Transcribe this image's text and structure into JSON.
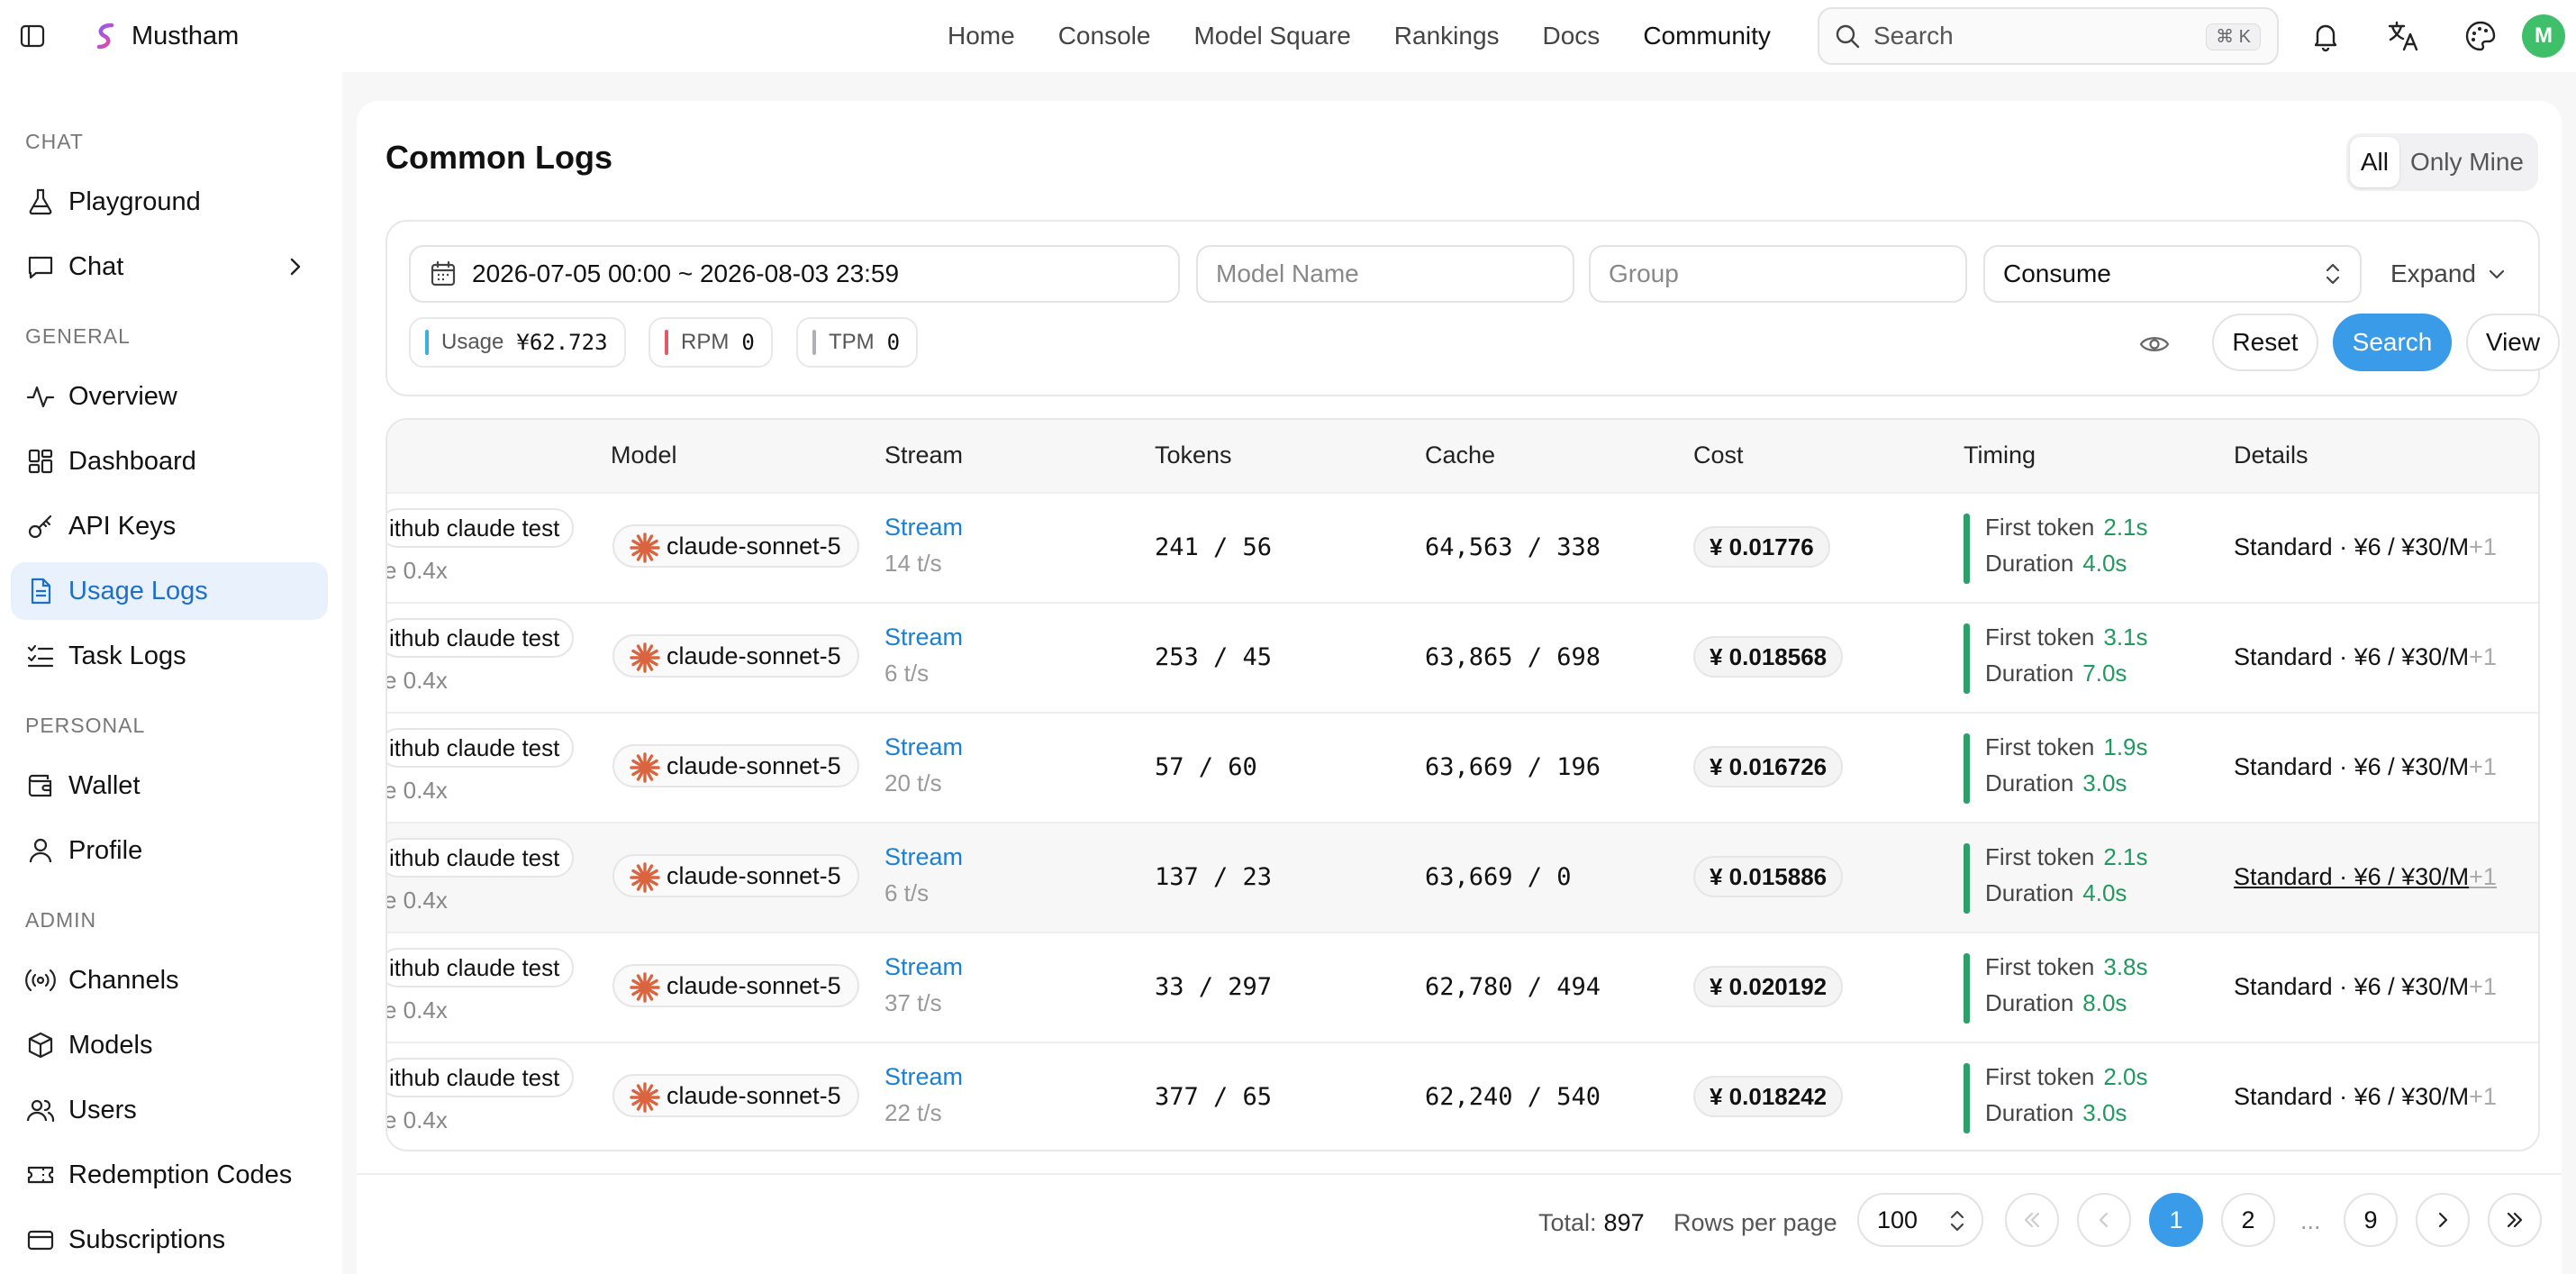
{
  "brand": "Mustham",
  "topnav": [
    "Home",
    "Console",
    "Model Square",
    "Rankings",
    "Docs",
    "Community"
  ],
  "search": {
    "placeholder": "Search",
    "shortcut": "⌘ K"
  },
  "avatar_letter": "M",
  "sidebar": {
    "sections": {
      "chat": "CHAT",
      "general": "GENERAL",
      "personal": "PERSONAL",
      "admin": "ADMIN"
    },
    "items": {
      "playground": "Playground",
      "chat": "Chat",
      "overview": "Overview",
      "dashboard": "Dashboard",
      "api_keys": "API Keys",
      "usage_logs": "Usage Logs",
      "task_logs": "Task Logs",
      "wallet": "Wallet",
      "profile": "Profile",
      "channels": "Channels",
      "models": "Models",
      "users": "Users",
      "redemption_codes": "Redemption Codes",
      "subscriptions": "Subscriptions"
    },
    "active": "usage_logs"
  },
  "page": {
    "title": "Common Logs",
    "scope_all": "All",
    "scope_mine": "Only Mine"
  },
  "filters": {
    "date_range": "2026-07-05 00:00 ~ 2026-08-03 23:59",
    "model_placeholder": "Model Name",
    "group_placeholder": "Group",
    "type_value": "Consume",
    "expand_label": "Expand",
    "stats": {
      "usage_label": "Usage",
      "usage_value": "¥62.723",
      "rpm_label": "RPM",
      "rpm_value": "0",
      "tpm_label": "TPM",
      "tpm_value": "0"
    },
    "reset_label": "Reset",
    "search_label": "Search",
    "view_label": "View"
  },
  "table": {
    "headers": {
      "model": "Model",
      "stream": "Stream",
      "tokens": "Tokens",
      "cache": "Cache",
      "cost": "Cost",
      "timing": "Timing",
      "details": "Details"
    },
    "first_token_label": "First token",
    "duration_label": "Duration",
    "rows": [
      {
        "token": "ithub claude test",
        "ratio": "e 0.4x",
        "model": "claude-sonnet-5",
        "stream": "Stream",
        "tps": "14 t/s",
        "tokens": "241 / 56",
        "cache": "64,563 / 338",
        "cost": "¥ 0.01776",
        "first": "2.1s",
        "duration": "4.0s",
        "details": "Standard · ¥6 / ¥30/M",
        "more": "+1"
      },
      {
        "token": "ithub claude test",
        "ratio": "e 0.4x",
        "model": "claude-sonnet-5",
        "stream": "Stream",
        "tps": "6 t/s",
        "tokens": "253 / 45",
        "cache": "63,865 / 698",
        "cost": "¥ 0.018568",
        "first": "3.1s",
        "duration": "7.0s",
        "details": "Standard · ¥6 / ¥30/M",
        "more": "+1"
      },
      {
        "token": "ithub claude test",
        "ratio": "e 0.4x",
        "model": "claude-sonnet-5",
        "stream": "Stream",
        "tps": "20 t/s",
        "tokens": "57 / 60",
        "cache": "63,669 / 196",
        "cost": "¥ 0.016726",
        "first": "1.9s",
        "duration": "3.0s",
        "details": "Standard · ¥6 / ¥30/M",
        "more": "+1"
      },
      {
        "token": "ithub claude test",
        "ratio": "e 0.4x",
        "model": "claude-sonnet-5",
        "stream": "Stream",
        "tps": "6 t/s",
        "tokens": "137 / 23",
        "cache": "63,669 / 0",
        "cost": "¥ 0.015886",
        "first": "2.1s",
        "duration": "4.0s",
        "details": "Standard · ¥6 / ¥30/M",
        "more": "+1"
      },
      {
        "token": "ithub claude test",
        "ratio": "e 0.4x",
        "model": "claude-sonnet-5",
        "stream": "Stream",
        "tps": "37 t/s",
        "tokens": "33 / 297",
        "cache": "62,780 / 494",
        "cost": "¥ 0.020192",
        "first": "3.8s",
        "duration": "8.0s",
        "details": "Standard · ¥6 / ¥30/M",
        "more": "+1"
      },
      {
        "token": "ithub claude test",
        "ratio": "e 0.4x",
        "model": "claude-sonnet-5",
        "stream": "Stream",
        "tps": "22 t/s",
        "tokens": "377 / 65",
        "cache": "62,240 / 540",
        "cost": "¥ 0.018242",
        "first": "2.0s",
        "duration": "3.0s",
        "details": "Standard · ¥6 / ¥30/M",
        "more": "+1"
      }
    ]
  },
  "pagination": {
    "total_label": "Total:",
    "total_value": "897",
    "rows_label": "Rows per page",
    "rows_value": "100",
    "pages": [
      "1",
      "2",
      "9"
    ],
    "ellipsis": "...",
    "current": "1"
  },
  "colors": {
    "accent": "#3a9be8",
    "link": "#1d7fd0",
    "green": "#1f9a5e",
    "usage_bar": "#3ab0e0",
    "rpm_bar": "#e05a6a",
    "tpm_bar": "#b0b0b8",
    "anthropic": "#d9643f"
  },
  "icons": {
    "sidebar_toggle": "sidebar-toggle-icon",
    "logo": "logo-icon",
    "bell": "bell-icon",
    "translate": "translate-icon",
    "palette": "palette-icon",
    "calendar": "calendar-icon",
    "eye": "eye-icon",
    "model": "anthropic-icon"
  }
}
